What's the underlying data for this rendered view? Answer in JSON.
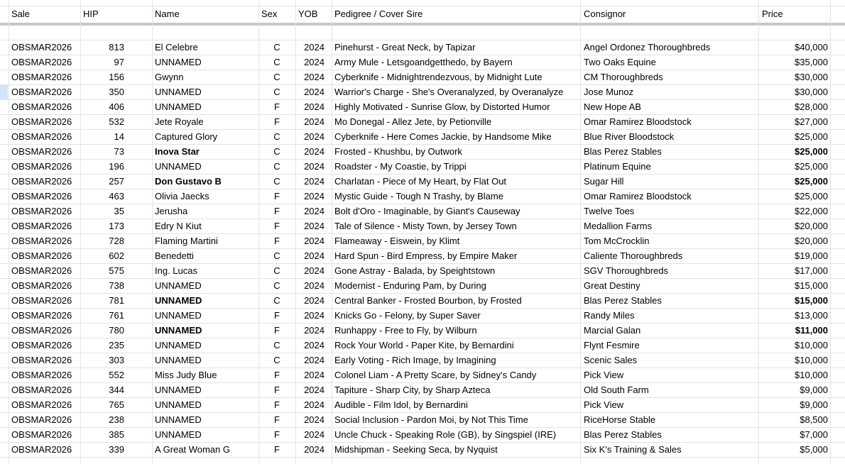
{
  "headers": {
    "sale": "Sale",
    "hip": "HIP",
    "name": "Name",
    "sex": "Sex",
    "yob": "YOB",
    "pedigree": "Pedigree / Cover Sire",
    "consignor": "Consignor",
    "price": "Price"
  },
  "rows": [
    {
      "sale": "OBSMAR2026",
      "hip": "813",
      "name": "El Celebre",
      "sex": "C",
      "yob": "2024",
      "pedigree": "Pinehurst - Great Neck, by Tapizar",
      "consignor": "Angel Ordonez Thoroughbreds",
      "price": "$40,000"
    },
    {
      "sale": "OBSMAR2026",
      "hip": "97",
      "name": "UNNAMED",
      "sex": "C",
      "yob": "2024",
      "pedigree": "Army Mule - Letsgoandgetthedo, by Bayern",
      "consignor": "Two Oaks Equine",
      "price": "$35,000"
    },
    {
      "sale": "OBSMAR2026",
      "hip": "156",
      "name": "Gwynn",
      "sex": "C",
      "yob": "2024",
      "pedigree": "Cyberknife - Midnightrendezvous, by Midnight Lute",
      "consignor": "CM Thoroughbreds",
      "price": "$30,000"
    },
    {
      "sale": "OBSMAR2026",
      "hip": "350",
      "name": "UNNAMED",
      "sex": "C",
      "yob": "2024",
      "pedigree": "Warrior's Charge - She's Overanalyzed, by Overanalyze",
      "consignor": "Jose Munoz",
      "price": "$30,000"
    },
    {
      "sale": "OBSMAR2026",
      "hip": "406",
      "name": "UNNAMED",
      "sex": "F",
      "yob": "2024",
      "pedigree": "Highly Motivated - Sunrise Glow, by Distorted Humor",
      "consignor": "New Hope AB",
      "price": "$28,000"
    },
    {
      "sale": "OBSMAR2026",
      "hip": "532",
      "name": "Jete Royale",
      "sex": "F",
      "yob": "2024",
      "pedigree": "Mo Donegal - Allez Jete, by Petionville",
      "consignor": "Omar Ramirez Bloodstock",
      "price": "$27,000"
    },
    {
      "sale": "OBSMAR2026",
      "hip": "14",
      "name": "Captured Glory",
      "sex": "C",
      "yob": "2024",
      "pedigree": "Cyberknife - Here Comes Jackie, by Handsome Mike",
      "consignor": "Blue River Bloodstock",
      "price": "$25,000"
    },
    {
      "sale": "OBSMAR2026",
      "hip": "73",
      "name": "Inova Star",
      "sex": "C",
      "yob": "2024",
      "pedigree": "Frosted - Khushbu, by Outwork",
      "consignor": "Blas Perez Stables",
      "price": "$25,000",
      "bold": true
    },
    {
      "sale": "OBSMAR2026",
      "hip": "196",
      "name": "UNNAMED",
      "sex": "C",
      "yob": "2024",
      "pedigree": "Roadster - My Coastie, by Trippi",
      "consignor": "Platinum Equine",
      "price": "$25,000"
    },
    {
      "sale": "OBSMAR2026",
      "hip": "257",
      "name": "Don Gustavo B",
      "sex": "C",
      "yob": "2024",
      "pedigree": "Charlatan - Piece of My Heart, by Flat Out",
      "consignor": "Sugar Hill",
      "price": "$25,000",
      "bold": true
    },
    {
      "sale": "OBSMAR2026",
      "hip": "463",
      "name": "Olivia Jaecks",
      "sex": "F",
      "yob": "2024",
      "pedigree": "Mystic Guide - Tough N Trashy, by Blame",
      "consignor": "Omar Ramirez Bloodstock",
      "price": "$25,000"
    },
    {
      "sale": "OBSMAR2026",
      "hip": "35",
      "name": "Jerusha",
      "sex": "F",
      "yob": "2024",
      "pedigree": "Bolt d'Oro - Imaginable, by Giant's Causeway",
      "consignor": "Twelve Toes",
      "price": "$22,000"
    },
    {
      "sale": "OBSMAR2026",
      "hip": "173",
      "name": "Edry N Kiut",
      "sex": "F",
      "yob": "2024",
      "pedigree": "Tale of Silence - Misty Town, by Jersey Town",
      "consignor": "Medallion Farms",
      "price": "$20,000"
    },
    {
      "sale": "OBSMAR2026",
      "hip": "728",
      "name": "Flaming Martini",
      "sex": "F",
      "yob": "2024",
      "pedigree": "Flameaway - Eiswein, by Klimt",
      "consignor": "Tom McCrocklin",
      "price": "$20,000"
    },
    {
      "sale": "OBSMAR2026",
      "hip": "602",
      "name": "Benedetti",
      "sex": "C",
      "yob": "2024",
      "pedigree": "Hard Spun - Bird Empress, by Empire Maker",
      "consignor": "Caliente Thoroughbreds",
      "price": "$19,000"
    },
    {
      "sale": "OBSMAR2026",
      "hip": "575",
      "name": "Ing. Lucas",
      "sex": "C",
      "yob": "2024",
      "pedigree": "Gone Astray - Balada, by Speightstown",
      "consignor": "SGV Thoroughbreds",
      "price": "$17,000"
    },
    {
      "sale": "OBSMAR2026",
      "hip": "738",
      "name": "UNNAMED",
      "sex": "C",
      "yob": "2024",
      "pedigree": "Modernist - Enduring Pam, by During",
      "consignor": "Great Destiny",
      "price": "$15,000"
    },
    {
      "sale": "OBSMAR2026",
      "hip": "781",
      "name": "UNNAMED",
      "sex": "C",
      "yob": "2024",
      "pedigree": "Central Banker - Frosted Bourbon, by Frosted",
      "consignor": "Blas Perez Stables",
      "price": "$15,000",
      "bold": true
    },
    {
      "sale": "OBSMAR2026",
      "hip": "761",
      "name": "UNNAMED",
      "sex": "F",
      "yob": "2024",
      "pedigree": "Knicks Go - Felony, by Super Saver",
      "consignor": "Randy Miles",
      "price": "$13,000"
    },
    {
      "sale": "OBSMAR2026",
      "hip": "780",
      "name": "UNNAMED",
      "sex": "F",
      "yob": "2024",
      "pedigree": "Runhappy - Free to Fly, by Wilburn",
      "consignor": "Marcial Galan",
      "price": "$11,000",
      "bold": true
    },
    {
      "sale": "OBSMAR2026",
      "hip": "235",
      "name": "UNNAMED",
      "sex": "C",
      "yob": "2024",
      "pedigree": "Rock Your World - Paper Kite, by Bernardini",
      "consignor": "Flynt Fesmire",
      "price": "$10,000"
    },
    {
      "sale": "OBSMAR2026",
      "hip": "303",
      "name": "UNNAMED",
      "sex": "C",
      "yob": "2024",
      "pedigree": "Early Voting - Rich Image, by Imagining",
      "consignor": "Scenic Sales",
      "price": "$10,000"
    },
    {
      "sale": "OBSMAR2026",
      "hip": "552",
      "name": "Miss Judy Blue",
      "sex": "F",
      "yob": "2024",
      "pedigree": "Colonel Liam - A Pretty Scare, by Sidney's Candy",
      "consignor": "Pick View",
      "price": "$10,000"
    },
    {
      "sale": "OBSMAR2026",
      "hip": "344",
      "name": "UNNAMED",
      "sex": "F",
      "yob": "2024",
      "pedigree": "Tapiture - Sharp City, by Sharp Azteca",
      "consignor": "Old South Farm",
      "price": "$9,000"
    },
    {
      "sale": "OBSMAR2026",
      "hip": "765",
      "name": "UNNAMED",
      "sex": "F",
      "yob": "2024",
      "pedigree": "Audible - Film Idol, by Bernardini",
      "consignor": "Pick View",
      "price": "$9,000"
    },
    {
      "sale": "OBSMAR2026",
      "hip": "238",
      "name": "UNNAMED",
      "sex": "F",
      "yob": "2024",
      "pedigree": "Social Inclusion - Pardon Moi, by Not This Time",
      "consignor": "RiceHorse Stable",
      "price": "$8,500"
    },
    {
      "sale": "OBSMAR2026",
      "hip": "385",
      "name": "UNNAMED",
      "sex": "F",
      "yob": "2024",
      "pedigree": "Uncle Chuck - Speaking Role (GB), by Singspiel (IRE)",
      "consignor": "Blas Perez Stables",
      "price": "$7,000"
    },
    {
      "sale": "OBSMAR2026",
      "hip": "339",
      "name": "A Great Woman G",
      "sex": "F",
      "yob": "2024",
      "pedigree": "Midshipman - Seeking Seca, by Nyquist",
      "consignor": "Six K's Training & Sales",
      "price": "$5,000"
    }
  ]
}
